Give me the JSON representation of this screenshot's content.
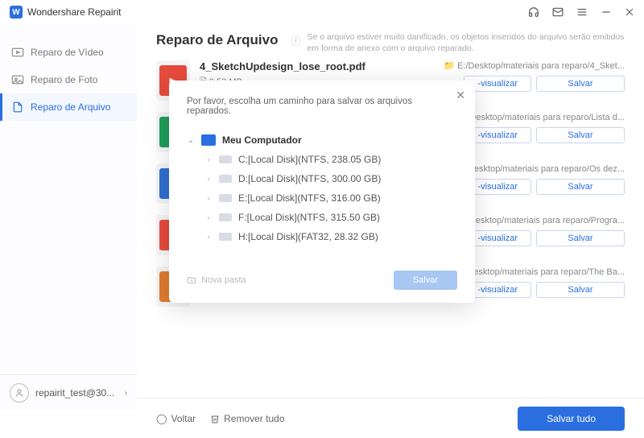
{
  "titlebar": {
    "title": "Wondershare Repairit"
  },
  "sidebar": {
    "items": [
      {
        "label": "Reparo de Vídeo"
      },
      {
        "label": "Reparo de Foto"
      },
      {
        "label": "Reparo de Arquivo"
      }
    ],
    "user": "repairit_test@30..."
  },
  "page": {
    "title": "Reparo de Arquivo",
    "hint": "Se o arquivo estiver muito danificado, os objetos inseridos do arquivo serão emitidos em forma de anexo com o arquivo reparado."
  },
  "files": [
    {
      "name": "4_SketchUpdesign_lose_root.pdf",
      "size": "8.52  MB",
      "path": "E:/Desktop/materiais para reparo/4_Sket...",
      "color": "#e64b3c",
      "tag": "▶",
      "preview": "-visualizar",
      "save": "Salvar"
    },
    {
      "name": "",
      "size": "",
      "path": ":/Desktop/materiais para reparo/Lista d...",
      "color": "#1e9e5a",
      "tag": "X",
      "preview": "-visualizar",
      "save": "Salvar"
    },
    {
      "name": "",
      "size": "",
      "path": ":/Desktop/materiais para reparo/Os dez...",
      "color": "#2f6fd0",
      "tag": "W",
      "preview": "-visualizar",
      "save": "Salvar"
    },
    {
      "name": "",
      "size": "",
      "path": ":/Desktop/materiais para reparo/Progra...",
      "color": "#e64b3c",
      "tag": "▶",
      "preview": "-visualizar",
      "save": "Salvar"
    },
    {
      "name": "",
      "size": "",
      "path": ":/Desktop/materiais para reparo/The Ba...",
      "color": "#e07b2f",
      "tag": "P",
      "preview": "-visualizar",
      "save": "Salvar"
    }
  ],
  "footer": {
    "back": "Voltar",
    "remove_all": "Remover tudo",
    "save_all": "Salvar tudo"
  },
  "modal": {
    "title": "Por favor, escolha um caminho para salvar os arquivos reparados.",
    "root": "Meu Computador",
    "disks": [
      "C:[Local Disk](NTFS, 238.05  GB)",
      "D:[Local Disk](NTFS, 300.00  GB)",
      "E:[Local Disk](NTFS, 316.00  GB)",
      "F:[Local Disk](NTFS, 315.50  GB)",
      "H:[Local Disk](FAT32, 28.32  GB)"
    ],
    "new_folder": "Nova pasta",
    "save": "Salvar"
  }
}
